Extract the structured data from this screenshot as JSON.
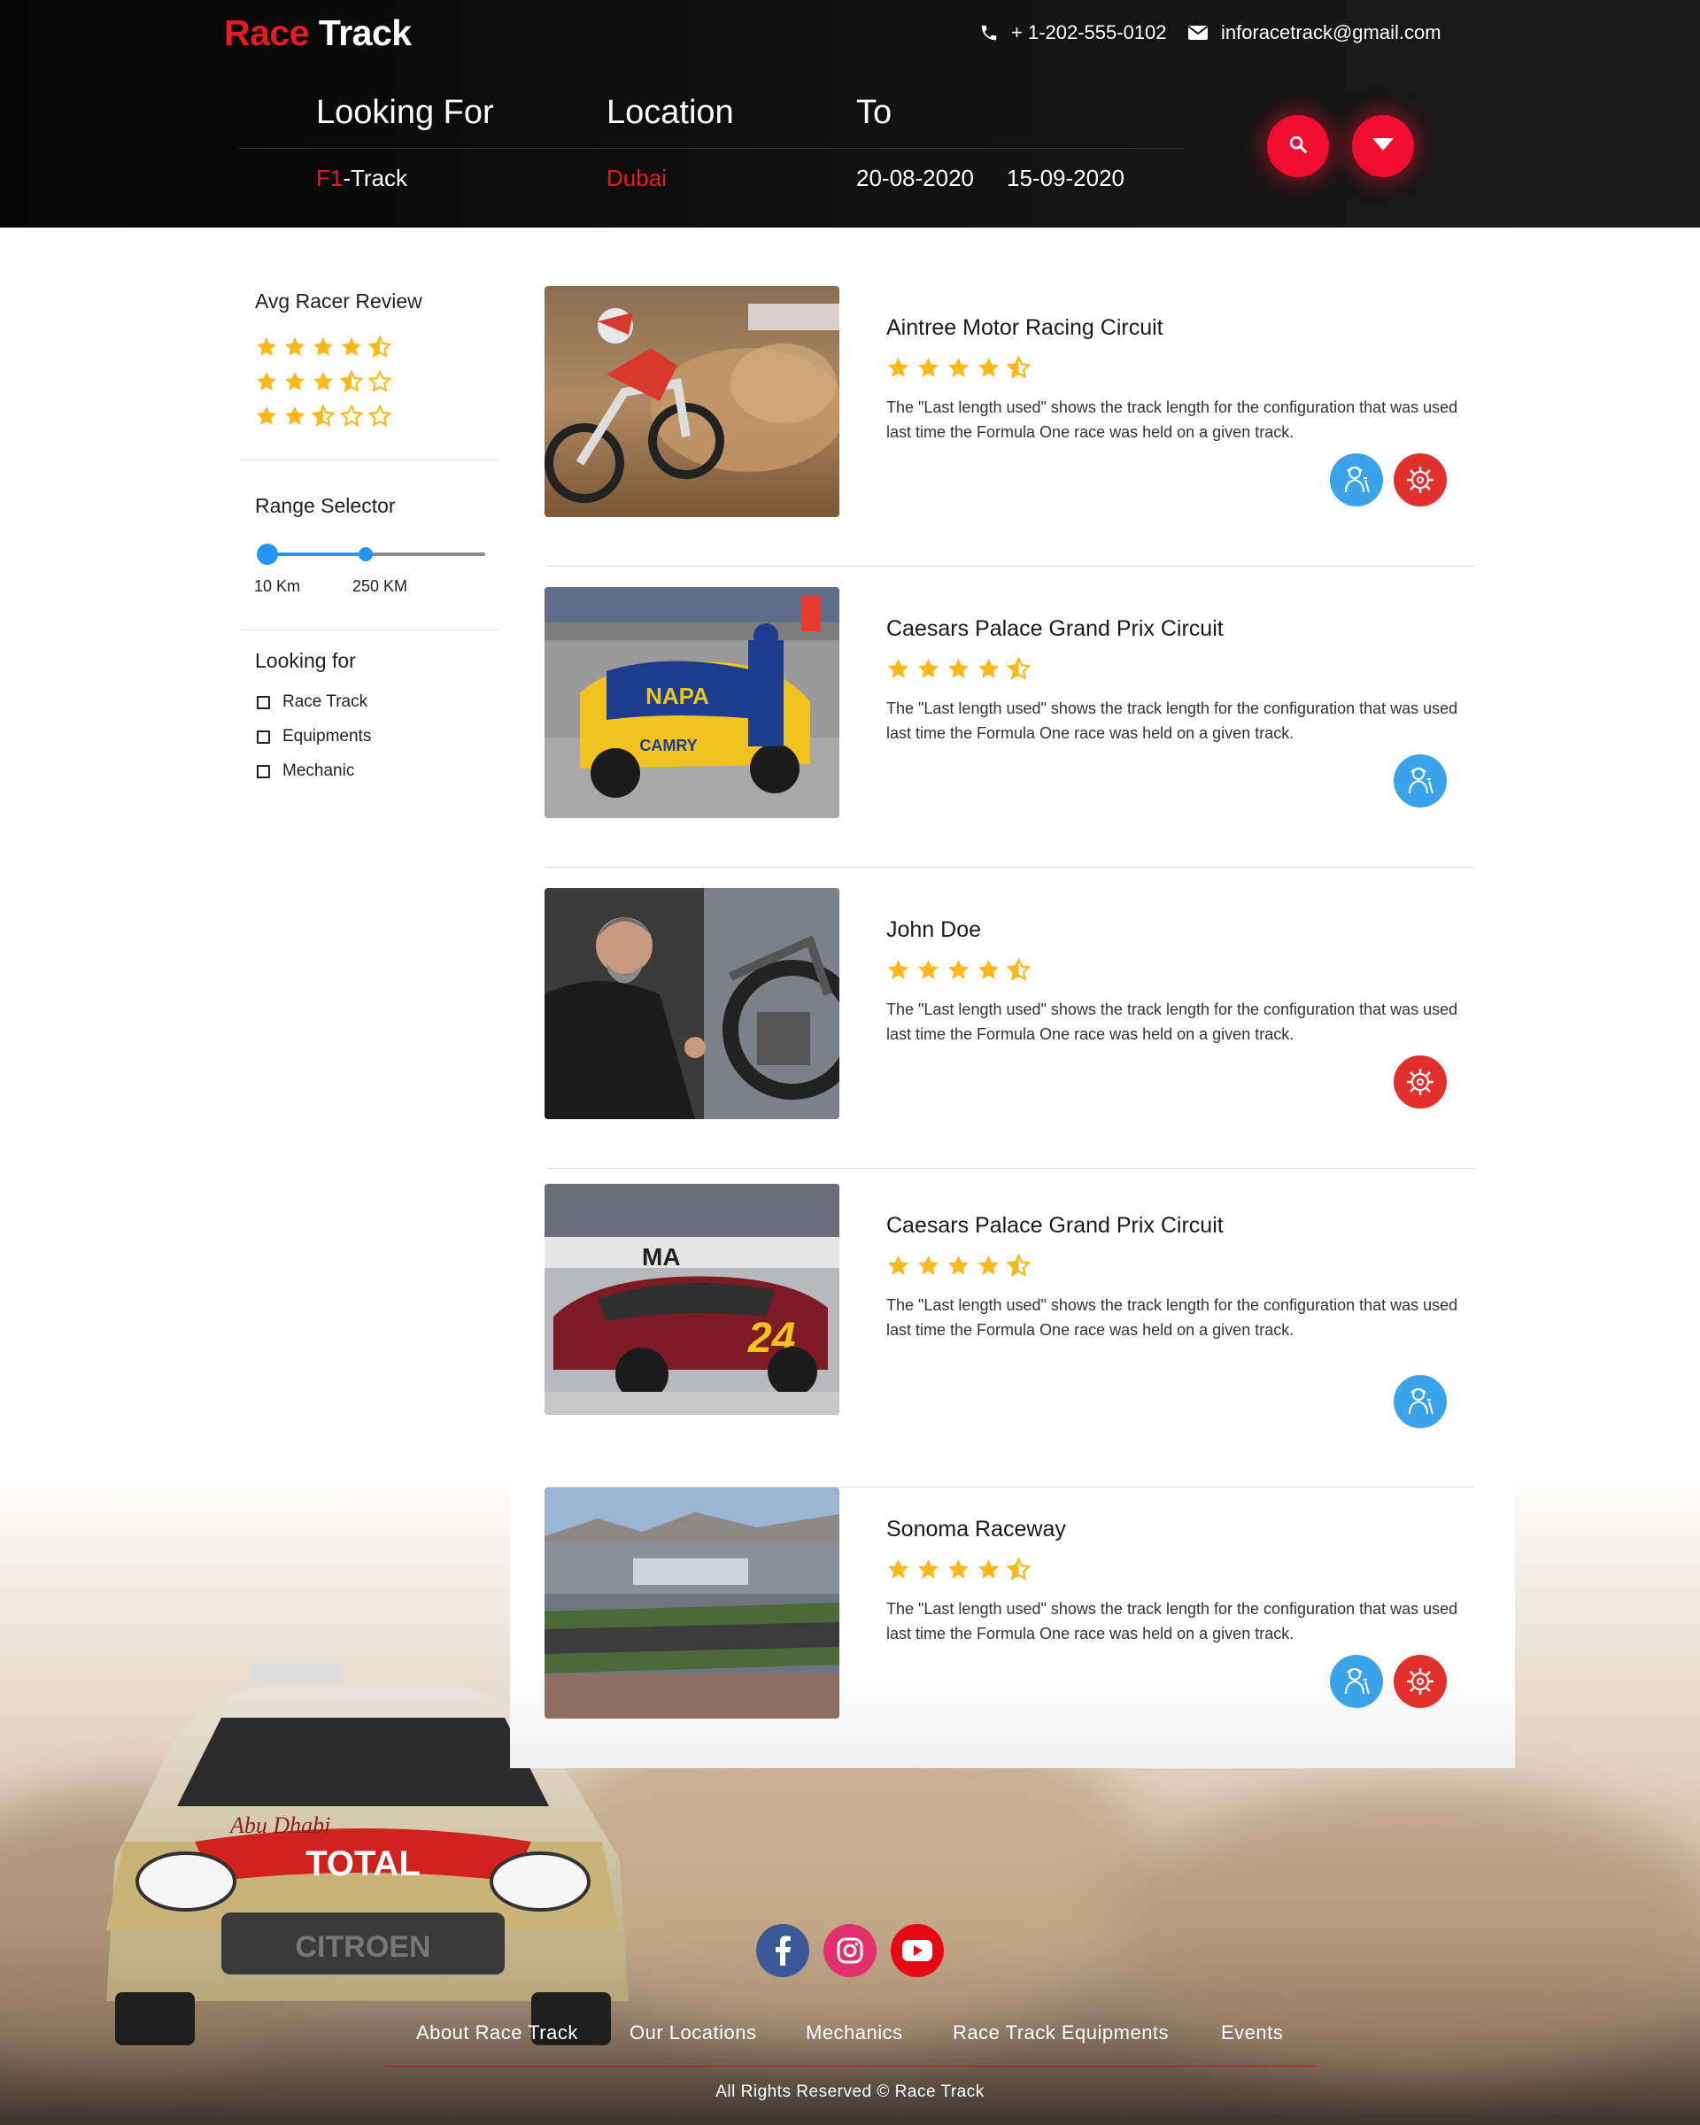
{
  "brand": {
    "name_part1": "Race",
    "name_part2": "Track"
  },
  "contact": {
    "phone": "+ 1-202-555-0102",
    "email": "inforacetrack@gmail.com",
    "phone_icon": "phone-icon",
    "email_icon": "envelope-icon"
  },
  "search": {
    "looking_for": {
      "label": "Looking For",
      "value_red": "F1",
      "value_white": "-Track"
    },
    "location": {
      "label": "Location",
      "value": "Dubai"
    },
    "to": {
      "label": "To",
      "date_from": "20-08-2020",
      "date_to": "15-09-2020"
    },
    "search_icon": "search-icon",
    "dropdown_icon": "caret-down-icon"
  },
  "sidebar": {
    "review_title": "Avg Racer Review",
    "review_rows": [
      4.5,
      3.5,
      2.5
    ],
    "range_title": "Range Selector",
    "range_min_label": "10 Km",
    "range_max_label": "250 KM",
    "range_value_fraction": 0.45,
    "looking_title": "Looking for",
    "options": [
      {
        "label": "Race Track",
        "checked": false
      },
      {
        "label": "Equipments",
        "checked": false
      },
      {
        "label": "Mechanic",
        "checked": false
      }
    ]
  },
  "results": [
    {
      "title": "Aintree Motor Racing Circuit",
      "rating": 4.5,
      "description": "The \"Last length used\" shows the track length for the configuration that was used last time the Formula One race was held on a given track.",
      "icons": [
        "mechanic-icon",
        "gear-icon"
      ],
      "image": "motocross-photo"
    },
    {
      "title": "Caesars Palace Grand Prix Circuit",
      "rating": 4.5,
      "description": "The \"Last length used\" shows the track length for the configuration that was used last time the Formula One race was held on a given track.",
      "icons": [
        "mechanic-icon"
      ],
      "image": "napa-camry-pitstop-photo",
      "image_text": [
        "NAPA",
        "CAMRY"
      ]
    },
    {
      "title": "John Doe",
      "rating": 4.5,
      "description": "The \"Last length used\" shows the track length for the configuration that was used last time the Formula One race was held on a given track.",
      "icons": [
        "gear-icon"
      ],
      "image": "mechanic-photo"
    },
    {
      "title": "Caesars Palace Grand Prix Circuit",
      "rating": 4.5,
      "description": "The \"Last length used\" shows the track length for the configuration that was used last time the Formula One race was held on a given track.",
      "icons": [
        "mechanic-icon"
      ],
      "image": "stock-car-24-photo",
      "image_text": [
        "24",
        "MA"
      ]
    },
    {
      "title": "Sonoma Raceway",
      "rating": 4.5,
      "description": "The \"Last length used\" shows the track length for the configuration that was used last time the Formula One race was held on a given track.",
      "icons": [
        "mechanic-icon",
        "gear-icon"
      ],
      "image": "raceway-aerial-photo"
    }
  ],
  "footer": {
    "social": [
      {
        "name": "facebook-icon",
        "color": "#3b5998"
      },
      {
        "name": "instagram-icon",
        "color": "#e1306c"
      },
      {
        "name": "youtube-icon",
        "color": "#e50914"
      }
    ],
    "nav": [
      "About Race Track",
      "Our Locations",
      "Mechanics",
      "Race Track Equipments",
      "Events"
    ],
    "copyright": "All Rights Reserved © Race Track",
    "car_livery": [
      "TOTAL",
      "Abu Dhabi",
      "CITROEN"
    ]
  },
  "colors": {
    "accent_red": "#e31b23",
    "button_red": "#f10d2f",
    "star_yellow": "#f9b81c",
    "icon_blue": "#3aa3ea",
    "icon_red": "#e2312d",
    "slider_blue": "#2196f3"
  }
}
